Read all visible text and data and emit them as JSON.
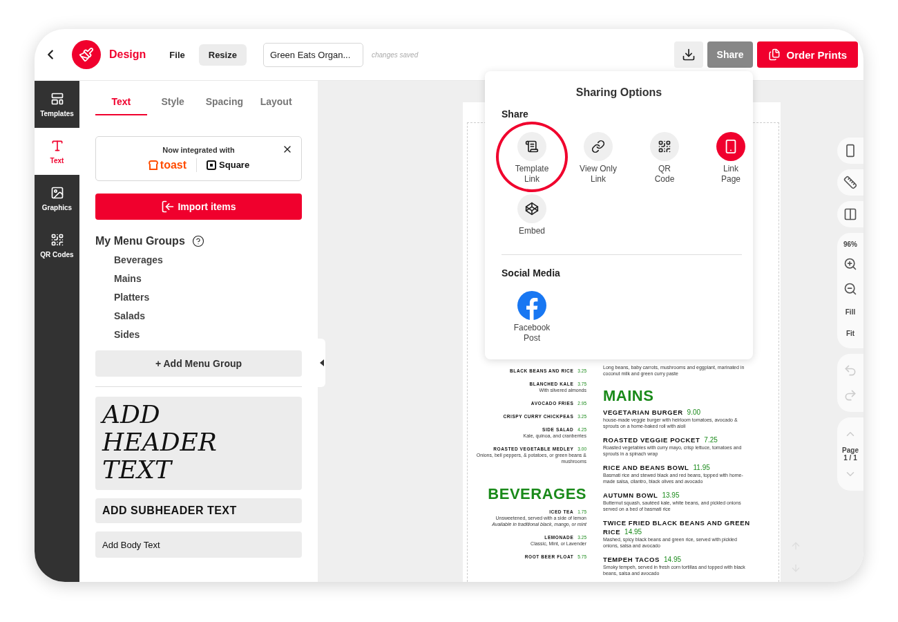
{
  "header": {
    "app_name": "Design",
    "menu": [
      {
        "label": "File",
        "selected": false
      },
      {
        "label": "Resize",
        "selected": true
      }
    ],
    "document_name": "Green Eats Organ...",
    "save_status": "changes saved",
    "share_button": "Share",
    "order_button": "Order Prints"
  },
  "rail": [
    {
      "label": "Templates",
      "selected": false
    },
    {
      "label": "Text",
      "selected": true
    },
    {
      "label": "Graphics",
      "selected": false
    },
    {
      "label": "QR Codes",
      "selected": false
    }
  ],
  "panel": {
    "tabs": [
      {
        "label": "Text",
        "selected": true
      },
      {
        "label": "Style",
        "selected": false
      },
      {
        "label": "Spacing",
        "selected": false
      },
      {
        "label": "Layout",
        "selected": false
      }
    ],
    "integration": {
      "title": "Now integrated with",
      "partners": [
        "toast",
        "Square"
      ]
    },
    "import_button": "Import items",
    "groups_title": "My Menu Groups",
    "groups": [
      "Beverages",
      "Mains",
      "Platters",
      "Salads",
      "Sides"
    ],
    "add_group_button": "+ Add Menu Group",
    "text_styles": [
      {
        "kind": "header",
        "label": "ADD HEADER TEXT"
      },
      {
        "kind": "subheader",
        "label": "ADD SUBHEADER TEXT"
      },
      {
        "kind": "body",
        "label": "Add Body Text"
      }
    ]
  },
  "sharing": {
    "title": "Sharing Options",
    "share_heading": "Share",
    "options": [
      {
        "kind": "template",
        "label": "Template\nLink",
        "circled": true,
        "accent": false
      },
      {
        "kind": "link",
        "label": "View Only\nLink",
        "circled": false,
        "accent": false
      },
      {
        "kind": "qr",
        "label": "QR\nCode",
        "circled": false,
        "accent": false
      },
      {
        "kind": "page",
        "label": "Link\nPage",
        "circled": false,
        "accent": true
      },
      {
        "kind": "embed",
        "label": "Embed",
        "circled": false,
        "accent": false
      }
    ],
    "social_heading": "Social Media",
    "social": [
      {
        "label": "Facebook\nPost"
      }
    ]
  },
  "menu_page": {
    "left": [
      {
        "kind": "item",
        "name": "BLACK BEANS AND RICE",
        "price": "3.25"
      },
      {
        "kind": "item",
        "name": "BLANCHED KALE",
        "price": "3.75",
        "description": "With slivered almonds"
      },
      {
        "kind": "item",
        "name": "AVOCADO FRIES",
        "price": "2.95"
      },
      {
        "kind": "item",
        "name": "CRISPY CURRY CHICKPEAS",
        "price": "3.25"
      },
      {
        "kind": "item",
        "name": "SIDE SALAD",
        "price": "4.25",
        "description": "Kale, quinoa, and cranberries"
      },
      {
        "kind": "item",
        "name": "ROASTED VEGETABLE MEDLEY",
        "price": "3.00",
        "description": "Onions, bell peppers, & potatoes, or green beans & mushrooms"
      },
      {
        "kind": "heading",
        "name": "BEVERAGES"
      },
      {
        "kind": "item",
        "name": "ICED TEA",
        "price": "1.75",
        "description": "Unsweetened, served with a side of lemon",
        "note": "Available in traditional black, mango, or mint"
      },
      {
        "kind": "item",
        "name": "LEMONADE",
        "price": "3.25",
        "description": "Classic, Mint, or Lavender"
      },
      {
        "kind": "item",
        "name": "ROOT BEER FLOAT",
        "price": "5.75"
      }
    ],
    "right": [
      {
        "kind": "item",
        "description": "Long beans, baby carrots, mushrooms and eggplant, marinated in coconut milk and green curry paste"
      },
      {
        "kind": "heading",
        "name": "MAINS"
      },
      {
        "kind": "item",
        "name": "VEGETARIAN BURGER",
        "price": "9.00",
        "description": "house-made veggie burger with heirloom tomatoes, avocado & sprouts on a home-baked roll with aioli"
      },
      {
        "kind": "item",
        "name": "ROASTED VEGGIE POCKET",
        "price": "7.25",
        "description": "Roasted vegetables with curry mayo, crisp lettuce, tomatoes and sprouts in a spinach wrap"
      },
      {
        "kind": "item",
        "name": "RICE AND BEANS BOWL",
        "price": "11.95",
        "description": "Basmati rice and stewed black and red beans, topped with home-made salsa, cilantro, black olives and avocado"
      },
      {
        "kind": "item",
        "name": "AUTUMN BOWL",
        "price": "13.95",
        "description": "Butternut squash, sautéed kale, white beans, and pickled onions served on a bed of basmati rice"
      },
      {
        "kind": "item",
        "name": "TWICE FRIED BLACK BEANS AND GREEN RICE",
        "price": "14.95",
        "description": "Mashed, spicy black beans and green rice, served with pickled onions, salsa and avocado"
      },
      {
        "kind": "item",
        "name": "TEMPEH TACOS",
        "price": "14.95",
        "description": "Smoky tempeh, served in fresh corn tortillas and topped with black beans, salsa and avocado"
      }
    ]
  },
  "toolbar": {
    "zoom": "96%",
    "fill": "Fill",
    "fit": "Fit",
    "undo_disabled": true,
    "redo_disabled": true,
    "page_label": "Page",
    "page_count": "1 / 1",
    "prev_disabled": true,
    "next_disabled": true
  }
}
